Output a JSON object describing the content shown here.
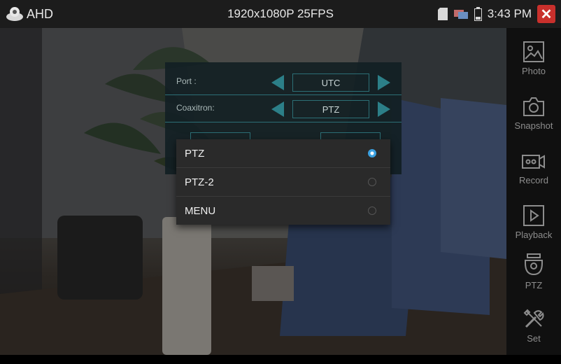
{
  "statusbar": {
    "app_name": "AHD",
    "resolution": "1920x1080P 25FPS",
    "time": "3:43 PM",
    "close_symbol": "✕"
  },
  "toolbar": {
    "items": [
      {
        "label": "Photo",
        "icon": "photo-icon"
      },
      {
        "label": "Snapshot",
        "icon": "camera-icon"
      },
      {
        "label": "Record",
        "icon": "record-icon"
      },
      {
        "label": "Playback",
        "icon": "play-icon"
      },
      {
        "label": "PTZ",
        "icon": "ptz-camera-icon"
      },
      {
        "label": "Set",
        "icon": "tools-icon"
      }
    ]
  },
  "settings": {
    "rows": [
      {
        "label": "Port :",
        "value": "UTC"
      },
      {
        "label": "Coaxitron:",
        "value": "PTZ"
      }
    ]
  },
  "dropdown": {
    "options": [
      {
        "label": "PTZ",
        "selected": true
      },
      {
        "label": "PTZ-2",
        "selected": false
      },
      {
        "label": "MENU",
        "selected": false
      }
    ]
  },
  "colors": {
    "accent": "#3aa0e0",
    "close": "#c9302c",
    "dialog_border": "#2c7f88"
  }
}
